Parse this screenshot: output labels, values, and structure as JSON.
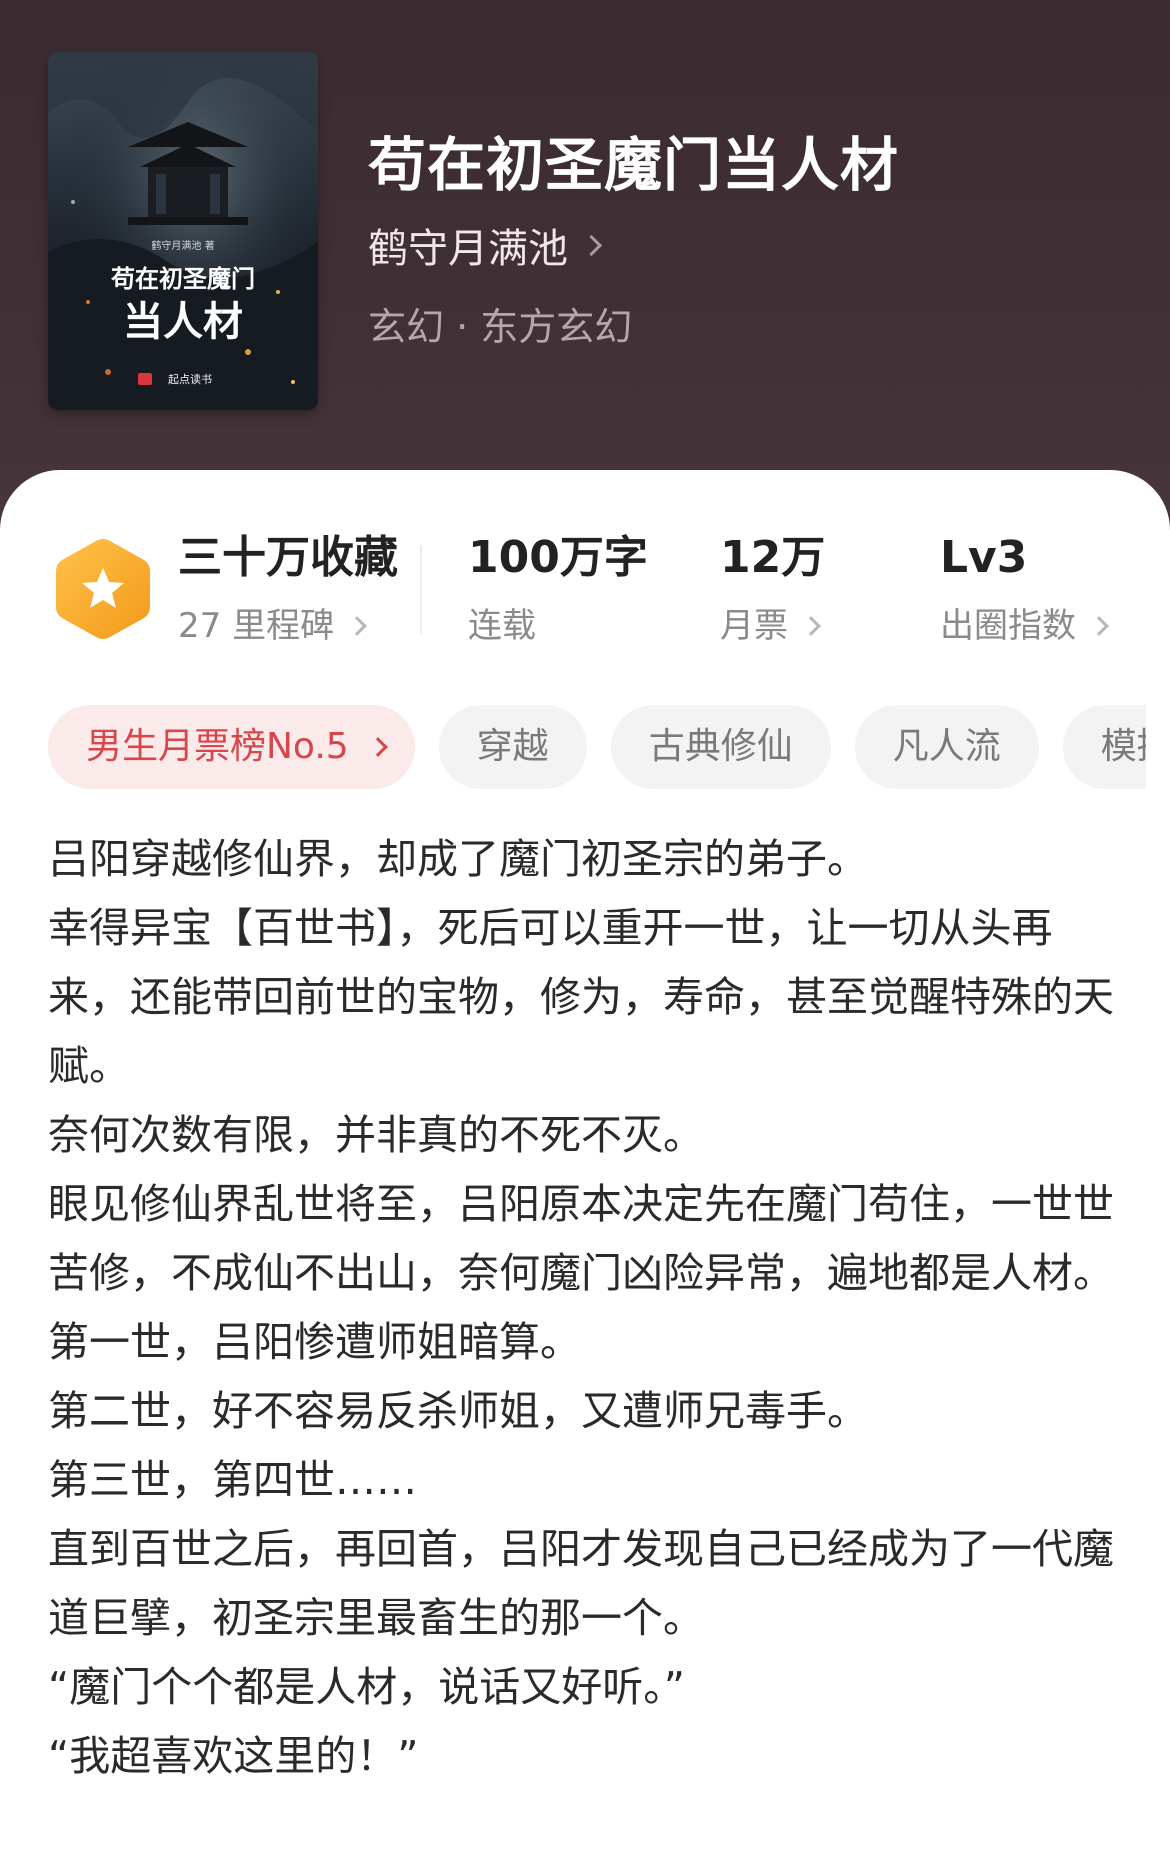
{
  "book": {
    "title": "苟在初圣魔门当人材",
    "author": "鹤守月满池",
    "genre": "玄幻 · 东方玄幻",
    "cover": {
      "byline": "鹤守月满池 著",
      "title_line1": "苟在初圣魔门",
      "title_line2": "当人材",
      "publisher": "起点读书"
    }
  },
  "stats": {
    "collections": {
      "value": "三十万收藏",
      "sub": "27 里程碑"
    },
    "words": {
      "value": "100万字",
      "sub": "连载"
    },
    "tickets": {
      "value": "12万",
      "sub": "月票"
    },
    "level": {
      "value": "Lv3",
      "sub": "出圈指数"
    }
  },
  "tags": [
    "男生月票榜No.5",
    "穿越",
    "古典修仙",
    "凡人流",
    "模拟"
  ],
  "description": [
    "吕阳穿越修仙界，却成了魔门初圣宗的弟子。",
    "幸得异宝【百世书】，死后可以重开一世，让一切从头再来，还能带回前世的宝物，修为，寿命，甚至觉醒特殊的天赋。",
    "奈何次数有限，并非真的不死不灭。",
    "眼见修仙界乱世将至，吕阳原本决定先在魔门苟住，一世世苦修，不成仙不出山，奈何魔门凶险异常，遍地都是人材。",
    "第一世，吕阳惨遭师姐暗算。",
    "第二世，好不容易反杀师姐，又遭师兄毒手。",
    "第三世，第四世……",
    "直到百世之后，再回首，吕阳才发现自己已经成为了一代魔道巨擘，初圣宗里最畜生的那一个。",
    "“魔门个个都是人材，说话又好听。”",
    "“我超喜欢这里的！”"
  ],
  "colors": {
    "header_bg": "#3e2f34",
    "badge_orange": "#f5a623",
    "rank_tag_bg": "#fbeaea",
    "rank_tag_text": "#d8464b"
  }
}
